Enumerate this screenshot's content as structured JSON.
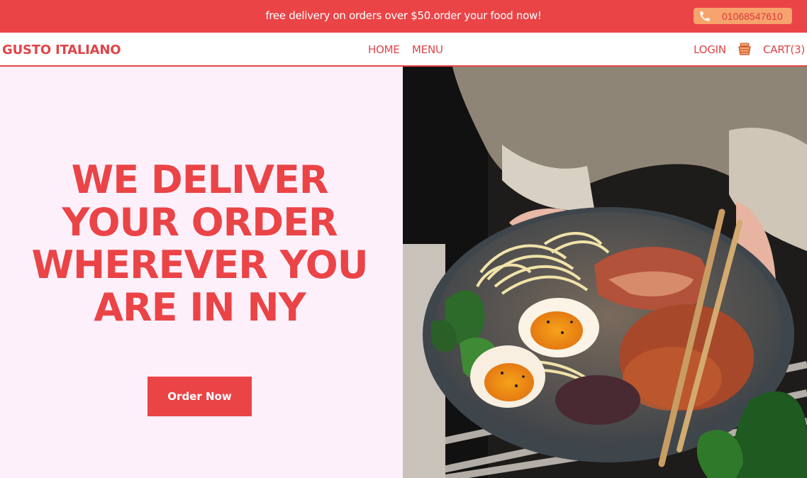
{
  "topbar": {
    "promo_text": "free delivery on orders over $50.order your food now!",
    "phone_icon": "phone-icon",
    "phone_number": "01068547610"
  },
  "nav": {
    "brand": "GUSTO ITALIANO",
    "links": [
      {
        "label": "HOME"
      },
      {
        "label": "MENU"
      }
    ],
    "login": "LOGIN",
    "cart_icon": "basket-icon",
    "cart_label": "CART(3)"
  },
  "hero": {
    "headline_lines": [
      "WE DELIVER",
      "YOUR ORDER",
      "WHEREVER YOU",
      "ARE IN NY"
    ],
    "cta_label": "Order Now",
    "image_subject": "ramen-bowl-photo"
  },
  "colors": {
    "accent": "#ea4447",
    "hero_bg": "#fdf0fb",
    "phone_badge": "#f6a36d"
  }
}
